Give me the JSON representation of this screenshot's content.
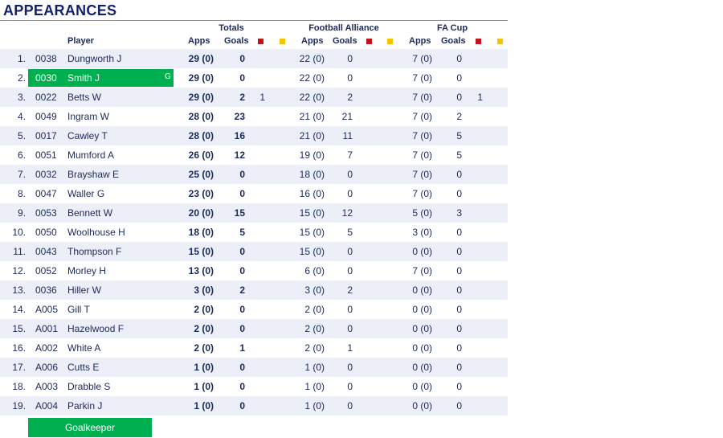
{
  "title": "APPEARANCES",
  "groups": {
    "totals": "Totals",
    "league": "Football Alliance",
    "cup": "FA Cup"
  },
  "headers": {
    "player": "Player",
    "apps": "Apps",
    "goals": "Goals"
  },
  "colors": {
    "goalkeeper": "#00b050",
    "red_card": "#c0141c",
    "yellow_card": "#f5c400",
    "stripe": "#eceef8"
  },
  "goalkeeper_marker": "G",
  "legend": {
    "goalkeeper": "Goalkeeper"
  },
  "players": [
    {
      "rank": "1.",
      "code": "0038",
      "name": "Dungworth J",
      "gk": false,
      "t_apps": "29 (0)",
      "t_goals": "0",
      "t_red": "",
      "l_apps": "22 (0)",
      "l_goals": "0",
      "c_apps": "7 (0)",
      "c_goals": "0",
      "c_red": ""
    },
    {
      "rank": "2.",
      "code": "0030",
      "name": "Smith J",
      "gk": true,
      "t_apps": "29 (0)",
      "t_goals": "0",
      "t_red": "",
      "l_apps": "22 (0)",
      "l_goals": "0",
      "c_apps": "7 (0)",
      "c_goals": "0",
      "c_red": ""
    },
    {
      "rank": "3.",
      "code": "0022",
      "name": "Betts W",
      "gk": false,
      "t_apps": "29 (0)",
      "t_goals": "2",
      "t_red": "1",
      "l_apps": "22 (0)",
      "l_goals": "2",
      "c_apps": "7 (0)",
      "c_goals": "0",
      "c_red": "1"
    },
    {
      "rank": "4.",
      "code": "0049",
      "name": "Ingram W",
      "gk": false,
      "t_apps": "28 (0)",
      "t_goals": "23",
      "t_red": "",
      "l_apps": "21 (0)",
      "l_goals": "21",
      "c_apps": "7 (0)",
      "c_goals": "2",
      "c_red": ""
    },
    {
      "rank": "5.",
      "code": "0017",
      "name": "Cawley T",
      "gk": false,
      "t_apps": "28 (0)",
      "t_goals": "16",
      "t_red": "",
      "l_apps": "21 (0)",
      "l_goals": "11",
      "c_apps": "7 (0)",
      "c_goals": "5",
      "c_red": ""
    },
    {
      "rank": "6.",
      "code": "0051",
      "name": "Mumford A",
      "gk": false,
      "t_apps": "26 (0)",
      "t_goals": "12",
      "t_red": "",
      "l_apps": "19 (0)",
      "l_goals": "7",
      "c_apps": "7 (0)",
      "c_goals": "5",
      "c_red": ""
    },
    {
      "rank": "7.",
      "code": "0032",
      "name": "Brayshaw E",
      "gk": false,
      "t_apps": "25 (0)",
      "t_goals": "0",
      "t_red": "",
      "l_apps": "18 (0)",
      "l_goals": "0",
      "c_apps": "7 (0)",
      "c_goals": "0",
      "c_red": ""
    },
    {
      "rank": "8.",
      "code": "0047",
      "name": "Waller G",
      "gk": false,
      "t_apps": "23 (0)",
      "t_goals": "0",
      "t_red": "",
      "l_apps": "16 (0)",
      "l_goals": "0",
      "c_apps": "7 (0)",
      "c_goals": "0",
      "c_red": ""
    },
    {
      "rank": "9.",
      "code": "0053",
      "name": "Bennett W",
      "gk": false,
      "t_apps": "20 (0)",
      "t_goals": "15",
      "t_red": "",
      "l_apps": "15 (0)",
      "l_goals": "12",
      "c_apps": "5 (0)",
      "c_goals": "3",
      "c_red": ""
    },
    {
      "rank": "10.",
      "code": "0050",
      "name": "Woolhouse H",
      "gk": false,
      "t_apps": "18 (0)",
      "t_goals": "5",
      "t_red": "",
      "l_apps": "15 (0)",
      "l_goals": "5",
      "c_apps": "3 (0)",
      "c_goals": "0",
      "c_red": ""
    },
    {
      "rank": "11.",
      "code": "0043",
      "name": "Thompson F",
      "gk": false,
      "t_apps": "15 (0)",
      "t_goals": "0",
      "t_red": "",
      "l_apps": "15 (0)",
      "l_goals": "0",
      "c_apps": "0 (0)",
      "c_goals": "0",
      "c_red": ""
    },
    {
      "rank": "12.",
      "code": "0052",
      "name": "Morley H",
      "gk": false,
      "t_apps": "13 (0)",
      "t_goals": "0",
      "t_red": "",
      "l_apps": "6 (0)",
      "l_goals": "0",
      "c_apps": "7 (0)",
      "c_goals": "0",
      "c_red": ""
    },
    {
      "rank": "13.",
      "code": "0036",
      "name": "Hiller W",
      "gk": false,
      "t_apps": "3 (0)",
      "t_goals": "2",
      "t_red": "",
      "l_apps": "3 (0)",
      "l_goals": "2",
      "c_apps": "0 (0)",
      "c_goals": "0",
      "c_red": ""
    },
    {
      "rank": "14.",
      "code": "A005",
      "name": "Gill T",
      "gk": false,
      "t_apps": "2 (0)",
      "t_goals": "0",
      "t_red": "",
      "l_apps": "2 (0)",
      "l_goals": "0",
      "c_apps": "0 (0)",
      "c_goals": "0",
      "c_red": ""
    },
    {
      "rank": "15.",
      "code": "A001",
      "name": "Hazelwood F",
      "gk": false,
      "t_apps": "2 (0)",
      "t_goals": "0",
      "t_red": "",
      "l_apps": "2 (0)",
      "l_goals": "0",
      "c_apps": "0 (0)",
      "c_goals": "0",
      "c_red": ""
    },
    {
      "rank": "16.",
      "code": "A002",
      "name": "White A",
      "gk": false,
      "t_apps": "2 (0)",
      "t_goals": "1",
      "t_red": "",
      "l_apps": "2 (0)",
      "l_goals": "1",
      "c_apps": "0 (0)",
      "c_goals": "0",
      "c_red": ""
    },
    {
      "rank": "17.",
      "code": "A006",
      "name": "Cutts E",
      "gk": false,
      "t_apps": "1 (0)",
      "t_goals": "0",
      "t_red": "",
      "l_apps": "1 (0)",
      "l_goals": "0",
      "c_apps": "0 (0)",
      "c_goals": "0",
      "c_red": ""
    },
    {
      "rank": "18.",
      "code": "A003",
      "name": "Drabble S",
      "gk": false,
      "t_apps": "1 (0)",
      "t_goals": "0",
      "t_red": "",
      "l_apps": "1 (0)",
      "l_goals": "0",
      "c_apps": "0 (0)",
      "c_goals": "0",
      "c_red": ""
    },
    {
      "rank": "19.",
      "code": "A004",
      "name": "Parkin J",
      "gk": false,
      "t_apps": "1 (0)",
      "t_goals": "0",
      "t_red": "",
      "l_apps": "1 (0)",
      "l_goals": "0",
      "c_apps": "0 (0)",
      "c_goals": "0",
      "c_red": ""
    }
  ]
}
